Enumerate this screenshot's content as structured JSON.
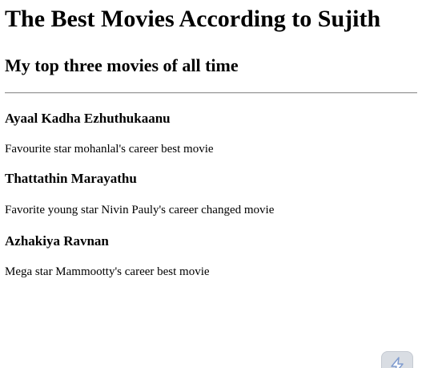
{
  "page": {
    "heading": "The Best Movies According to Sujith",
    "subheading": "My top three movies of all time"
  },
  "movies": [
    {
      "title": "Ayaal Kadha Ezhuthukaanu",
      "description": "Favourite star mohanlal's career best movie"
    },
    {
      "title": "Thattathin Marayathu",
      "description": "Favorite young star Nivin Pauly's career changed movie"
    },
    {
      "title": "Azhakiya Ravnan",
      "description": "Mega star Mammootty's career best movie"
    }
  ],
  "widget": {
    "icon": "lightning-bolt-icon",
    "accent": "#7f9bcf"
  }
}
